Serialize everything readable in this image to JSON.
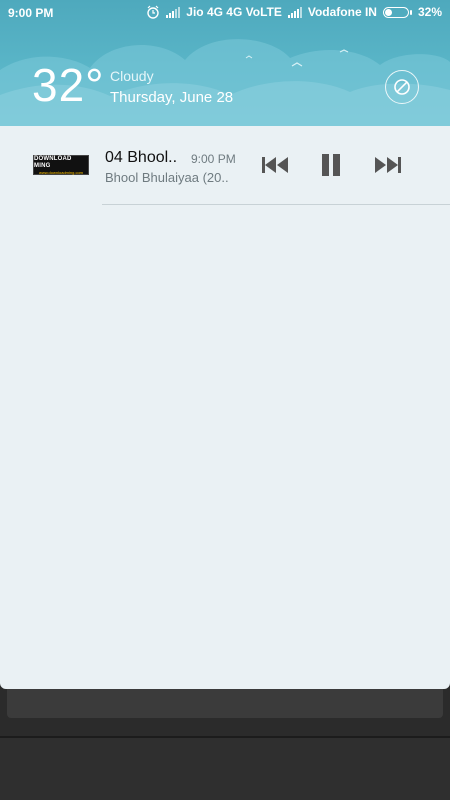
{
  "status_bar": {
    "time": "9:00 PM",
    "carrier1": "Jio 4G 4G VoLTE",
    "carrier2": "Vodafone IN",
    "battery_percent": "32%",
    "battery_level": 0.32
  },
  "weather": {
    "temperature": "32°",
    "condition": "Cloudy",
    "date": "Thursday, June 28"
  },
  "media_notification": {
    "album_art_text": "DOWNLOAD MING",
    "album_art_url": "www.downloadming.com",
    "title": "04 Bhool..",
    "time": "9:00 PM",
    "subtitle": "Bhool Bhulaiyaa (20..",
    "controls": [
      "previous-icon",
      "pause-icon",
      "next-icon"
    ]
  },
  "colors": {
    "header": "#5bb7c9",
    "panel": "#eaf1f4",
    "control": "#555555"
  }
}
